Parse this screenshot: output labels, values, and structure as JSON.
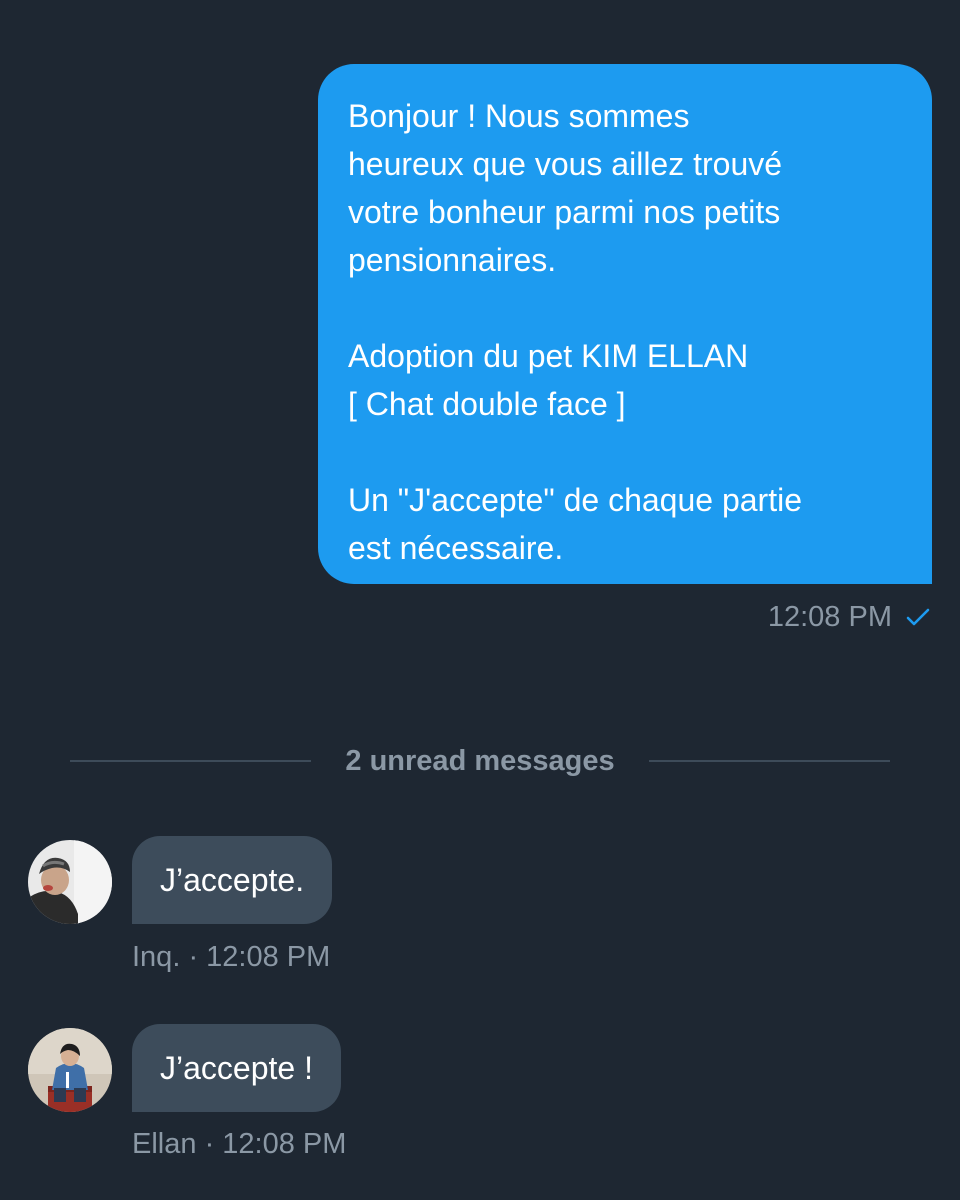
{
  "outgoing": {
    "text": "Bonjour ! Nous sommes\nheureux que vous aillez trouvé\nvotre bonheur parmi nos petits\npensionnaires.\n\nAdoption du pet KIM ELLAN\n[ Chat double face ]\n\nUn \"J'accepte\" de chaque partie\nest nécessaire.",
    "time": "12:08 PM",
    "status_icon": "check-icon"
  },
  "unread_divider": {
    "label": "2 unread messages"
  },
  "incoming": [
    {
      "text": "J’accepte.",
      "sender": "Inq.",
      "separator": "·",
      "time": "12:08 PM"
    },
    {
      "text": "J’accepte !",
      "sender": "Ellan",
      "separator": "·",
      "time": "12:08 PM"
    }
  ],
  "colors": {
    "background": "#1e2732",
    "outgoing_bubble": "#1d9bf0",
    "incoming_bubble": "#3d4c5b",
    "meta_text": "#8b98a5",
    "divider_line": "#3d4b59"
  }
}
